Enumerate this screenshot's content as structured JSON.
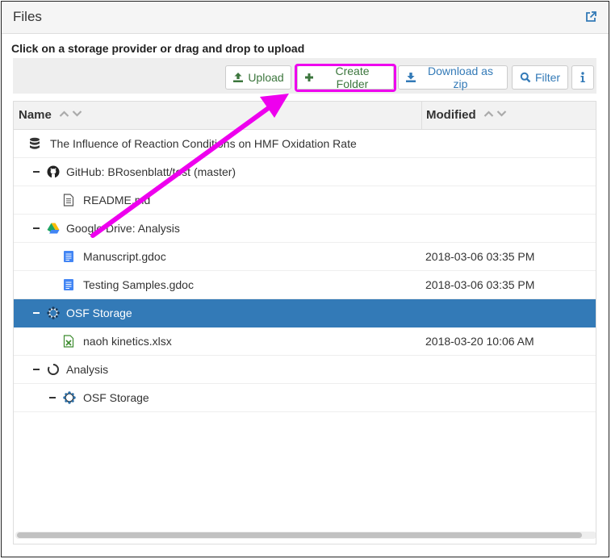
{
  "panel": {
    "title": "Files",
    "instruction": "Click on a storage provider or drag and drop to upload"
  },
  "toolbar": {
    "upload_label": "Upload",
    "create_folder_label": "Create Folder",
    "download_zip_label": "Download as zip",
    "filter_label": "Filter"
  },
  "columns": {
    "name": "Name",
    "modified": "Modified"
  },
  "rows": [
    {
      "label": "The Influence of Reaction Conditions on HMF Oxidation Rate",
      "icon": "database-icon",
      "modified": ""
    },
    {
      "label": "GitHub: BRosenblatt/test (master)",
      "icon": "github-icon",
      "modified": ""
    },
    {
      "label": "README.md",
      "icon": "text-file-icon",
      "modified": ""
    },
    {
      "label": "Google Drive: Analysis",
      "icon": "google-drive-icon",
      "modified": ""
    },
    {
      "label": "Manuscript.gdoc",
      "icon": "gdoc-icon",
      "modified": "2018-03-06 03:35 PM"
    },
    {
      "label": "Testing Samples.gdoc",
      "icon": "gdoc-icon",
      "modified": "2018-03-06 03:35 PM"
    },
    {
      "label": "OSF Storage",
      "icon": "osf-storage-icon",
      "modified": ""
    },
    {
      "label": "naoh kinetics.xlsx",
      "icon": "excel-file-icon",
      "modified": "2018-03-20 10:06 AM"
    },
    {
      "label": "Analysis",
      "icon": "component-icon",
      "modified": ""
    },
    {
      "label": "OSF Storage",
      "icon": "osf-storage-icon",
      "modified": ""
    }
  ],
  "colors": {
    "selected_row": "#337ab7",
    "highlight": "#ee00ee",
    "link": "#337ab7",
    "upload_green": "#3c763d"
  }
}
